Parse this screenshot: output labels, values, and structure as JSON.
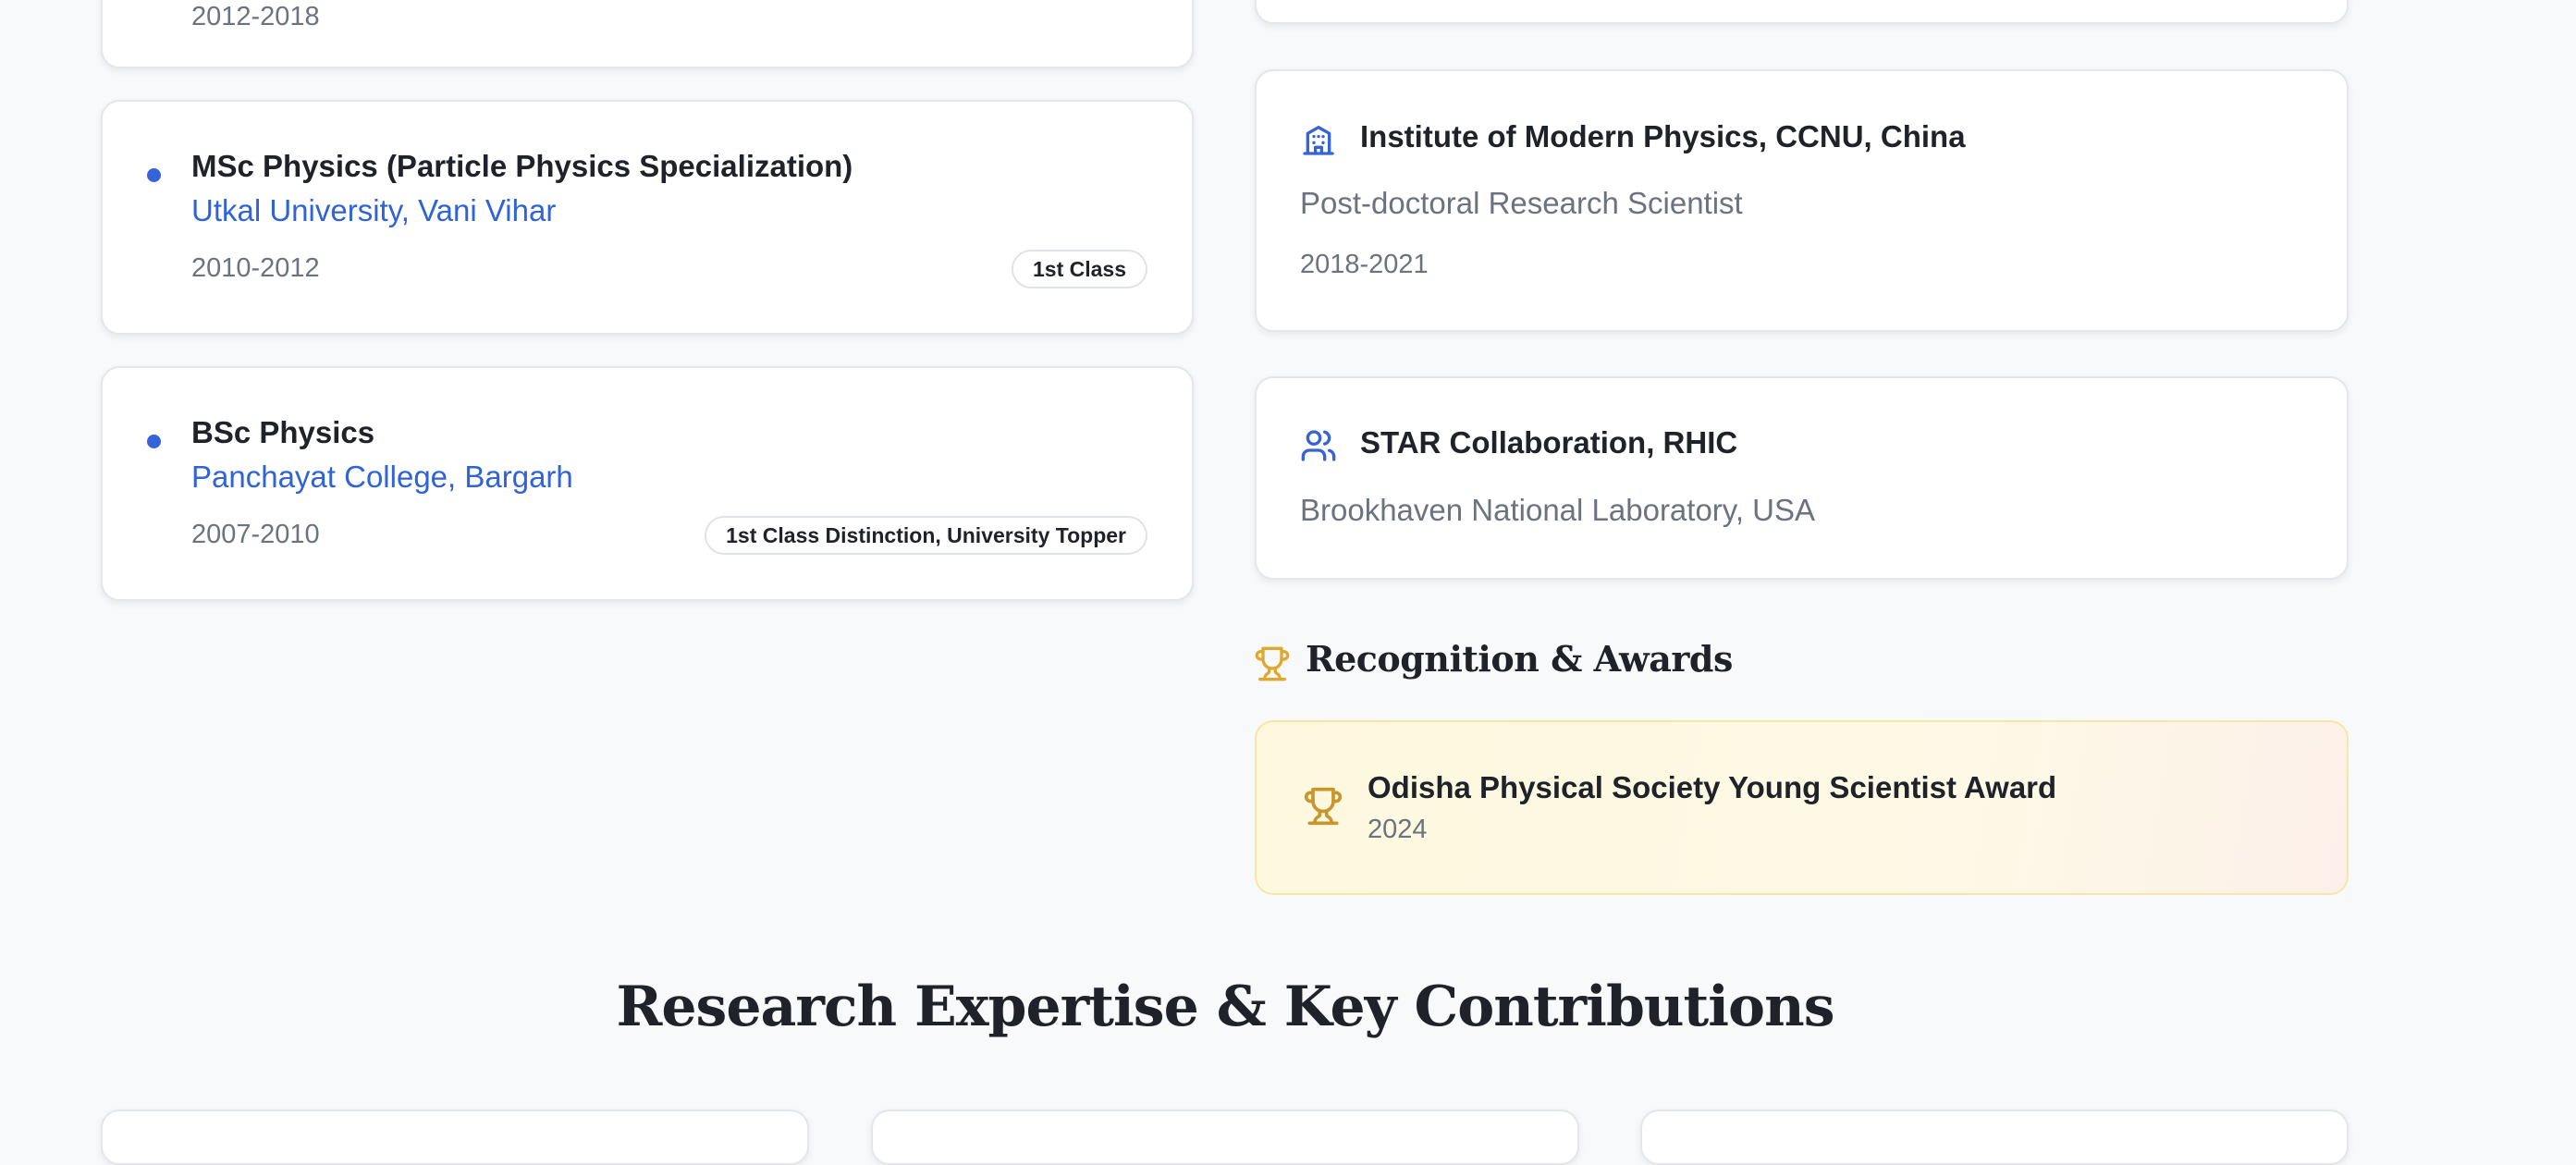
{
  "education": [
    {
      "years": "2012-2018"
    },
    {
      "degree": "MSc Physics (Particle Physics Specialization)",
      "institution": "Utkal University, Vani Vihar",
      "years": "2010-2012",
      "badge": "1st Class"
    },
    {
      "degree": "BSc Physics",
      "institution": "Panchayat College, Bargarh",
      "years": "2007-2010",
      "badge": "1st Class Distinction, University Topper"
    }
  ],
  "experience": [
    {
      "icon": "building-icon",
      "title": "Institute of Modern Physics, CCNU, China",
      "role": "Post-doctoral Research Scientist",
      "years": "2018-2021"
    },
    {
      "icon": "users-icon",
      "title": "STAR Collaboration, RHIC",
      "role": "Brookhaven National Laboratory, USA"
    }
  ],
  "awards": {
    "heading": "Recognition & Awards",
    "items": [
      {
        "name": "Odisha Physical Society Young Scientist Award",
        "year": "2024"
      }
    ]
  },
  "research": {
    "heading": "Research Expertise & Key Contributions"
  },
  "colors": {
    "accent_blue": "#2f63d6",
    "award_gold": "#c8962a",
    "background": "#f8f9fb"
  }
}
